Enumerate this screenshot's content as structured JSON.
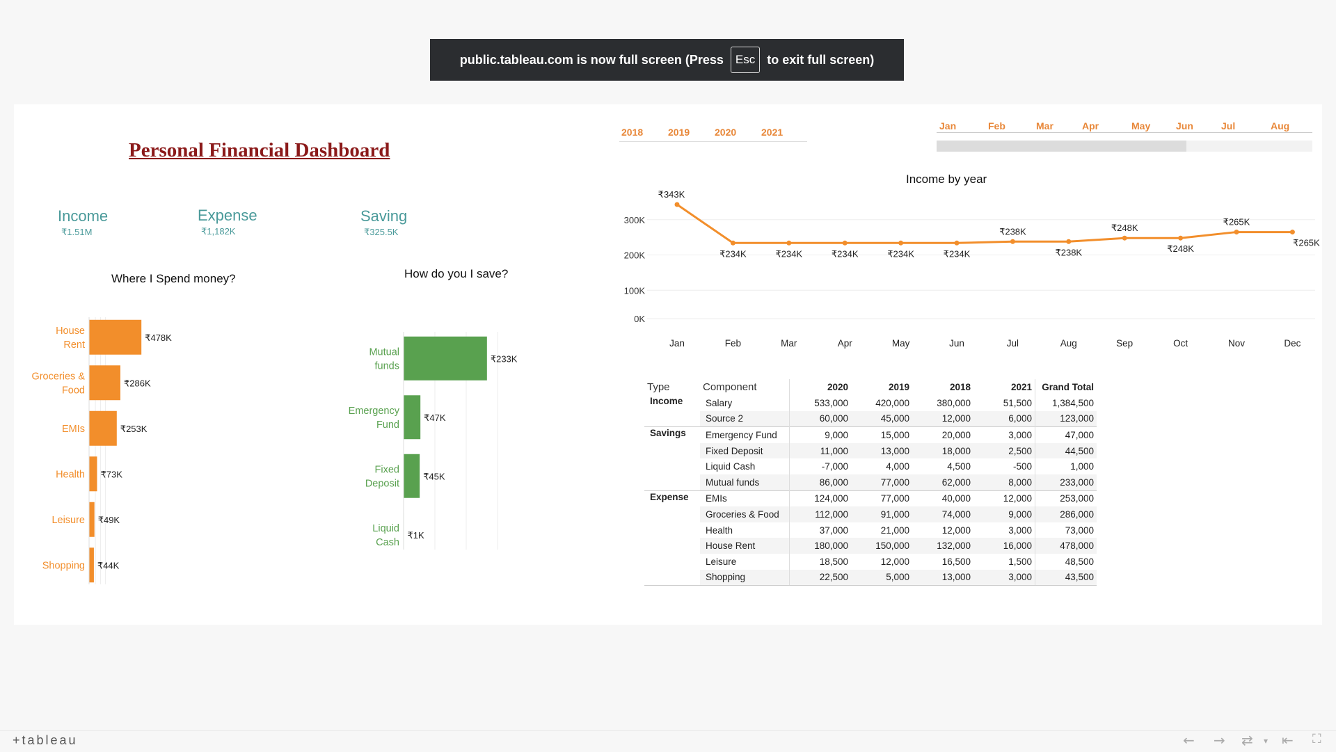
{
  "banner": {
    "pre": "public.tableau.com is now full screen (Press",
    "key": "Esc",
    "post": "to exit full screen)"
  },
  "dashboard": {
    "title": "Personal Financial Dashboard",
    "kpis": [
      {
        "label": "Income",
        "value": "₹1.51M"
      },
      {
        "label": "Expense",
        "value": "₹1,182K"
      },
      {
        "label": "Saving",
        "value": "₹325.5K"
      }
    ]
  },
  "filters": {
    "years": [
      "2018",
      "2019",
      "2020",
      "2021"
    ],
    "months": [
      "Jan",
      "Feb",
      "Mar",
      "Apr",
      "May",
      "Jun",
      "Jul",
      "Aug"
    ]
  },
  "colors": {
    "expense": "#f28e2b",
    "saving": "#59a14f",
    "income_line": "#f28e2b",
    "kpi": "#4a9a9a",
    "title": "#8b1a1a"
  },
  "chart_data": [
    {
      "type": "bar",
      "orientation": "horizontal",
      "title": "Where I Spend money?",
      "categories": [
        "House Rent",
        "Groceries & Food",
        "EMIs",
        "Health",
        "Leisure",
        "Shopping"
      ],
      "values": [
        478,
        286,
        253,
        73,
        49,
        44
      ],
      "data_labels": [
        "₹478K",
        "₹286K",
        "₹253K",
        "₹73K",
        "₹49K",
        "₹44K"
      ],
      "xlim": [
        0,
        700
      ],
      "grid": true
    },
    {
      "type": "bar",
      "orientation": "horizontal",
      "title": "How do you I save?",
      "categories": [
        "Mutual funds",
        "Emergency Fund",
        "Fixed Deposit",
        "Liquid Cash"
      ],
      "values": [
        233,
        47,
        45,
        1
      ],
      "data_labels": [
        "₹233K",
        "₹47K",
        "₹45K",
        "₹1K"
      ],
      "xlim": [
        0,
        350
      ],
      "grid": true
    },
    {
      "type": "line",
      "title": "Income by year",
      "x": [
        "Jan",
        "Feb",
        "Mar",
        "Apr",
        "May",
        "Jun",
        "Jul",
        "Aug",
        "Sep",
        "Oct",
        "Nov",
        "Dec"
      ],
      "values": [
        343,
        234,
        234,
        234,
        234,
        234,
        238,
        238,
        248,
        248,
        265,
        265
      ],
      "data_labels": [
        "₹343K",
        "₹234K",
        "₹234K",
        "₹234K",
        "₹234K",
        "₹234K",
        "₹238K",
        "₹238K",
        "₹248K",
        "₹248K",
        "₹265K",
        "₹265K"
      ],
      "yticks": [
        "0K",
        "100K",
        "200K",
        "300K"
      ],
      "ylim": [
        0,
        340
      ],
      "grid": true
    }
  ],
  "table": {
    "headers": [
      "Type",
      "Component",
      "2020",
      "2019",
      "2018",
      "2021",
      "Grand Total"
    ],
    "rows": [
      {
        "type": "Income",
        "component": "Salary",
        "values": [
          "533,000",
          "420,000",
          "380,000",
          "51,500",
          "1,384,500"
        ]
      },
      {
        "type": "",
        "component": "Source 2",
        "values": [
          "60,000",
          "45,000",
          "12,000",
          "6,000",
          "123,000"
        ]
      },
      {
        "type": "Savings",
        "component": "Emergency Fund",
        "values": [
          "9,000",
          "15,000",
          "20,000",
          "3,000",
          "47,000"
        ]
      },
      {
        "type": "",
        "component": "Fixed Deposit",
        "values": [
          "11,000",
          "13,000",
          "18,000",
          "2,500",
          "44,500"
        ]
      },
      {
        "type": "",
        "component": "Liquid Cash",
        "values": [
          "-7,000",
          "4,000",
          "4,500",
          "-500",
          "1,000"
        ]
      },
      {
        "type": "",
        "component": "Mutual funds",
        "values": [
          "86,000",
          "77,000",
          "62,000",
          "8,000",
          "233,000"
        ]
      },
      {
        "type": "Expense",
        "component": "EMIs",
        "values": [
          "124,000",
          "77,000",
          "40,000",
          "12,000",
          "253,000"
        ]
      },
      {
        "type": "",
        "component": "Groceries & Food",
        "values": [
          "112,000",
          "91,000",
          "74,000",
          "9,000",
          "286,000"
        ]
      },
      {
        "type": "",
        "component": "Health",
        "values": [
          "37,000",
          "21,000",
          "12,000",
          "3,000",
          "73,000"
        ]
      },
      {
        "type": "",
        "component": "House Rent",
        "values": [
          "180,000",
          "150,000",
          "132,000",
          "16,000",
          "478,000"
        ]
      },
      {
        "type": "",
        "component": "Leisure",
        "values": [
          "18,500",
          "12,000",
          "16,500",
          "1,500",
          "48,500"
        ]
      },
      {
        "type": "",
        "component": "Shopping",
        "values": [
          "22,500",
          "5,000",
          "13,000",
          "3,000",
          "43,500"
        ]
      }
    ]
  },
  "footer": {
    "logo": "+tableau"
  }
}
